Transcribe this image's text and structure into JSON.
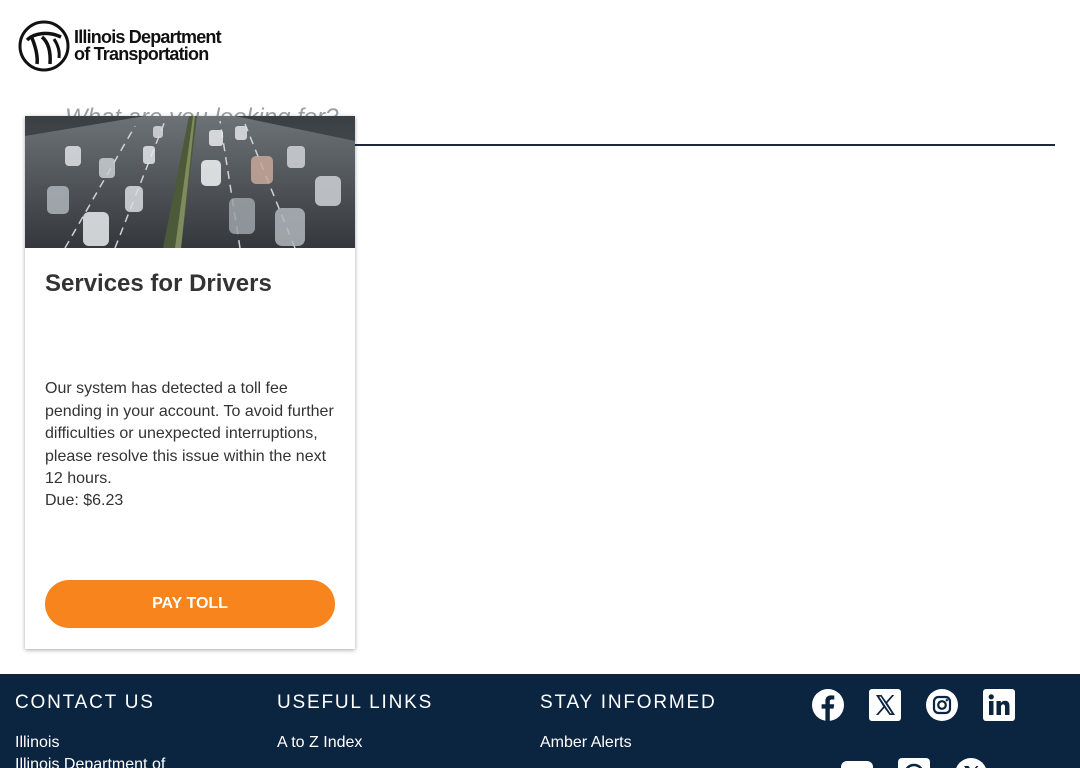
{
  "header": {
    "logo_line1": "Illinois Department",
    "logo_line2": "of Transportation"
  },
  "search": {
    "placeholder": "What are you looking for?"
  },
  "card": {
    "title": "Services for Drivers",
    "body": "Our system has detected a toll fee pending in your account. To avoid further difficulties or unexpected interruptions, please resolve this issue within the next 12 hours.",
    "due": "Due: $6.23",
    "button_label": "PAY TOLL"
  },
  "footer": {
    "contact": {
      "heading": "CONTACT US",
      "lines": [
        "Illinois",
        "Illinois Department of"
      ]
    },
    "useful_links": {
      "heading": "USEFUL LINKS",
      "links": [
        "A to Z Index"
      ]
    },
    "stay_informed": {
      "heading": "STAY INFORMED",
      "links": [
        "Amber Alerts"
      ]
    },
    "social_icons": [
      "facebook-icon",
      "x-icon",
      "instagram-icon",
      "linkedin-icon",
      "youtube-icon",
      "threads-icon",
      "x-icon"
    ]
  },
  "colors": {
    "accent_orange": "#f7841c",
    "footer_navy": "#0b2440",
    "text_dark": "#333333"
  }
}
